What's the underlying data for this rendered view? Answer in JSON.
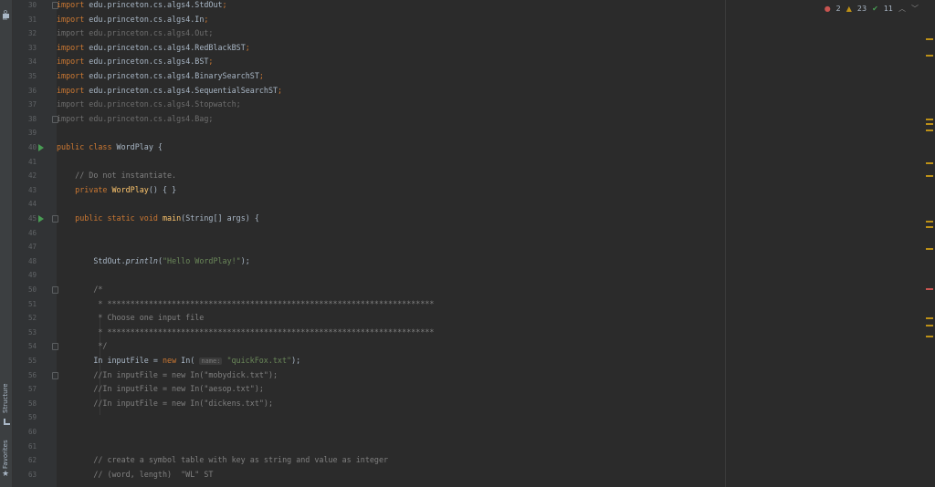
{
  "tool_windows": {
    "project": "Pro",
    "structure": "Structure",
    "favorites": "Favorites"
  },
  "inspections": {
    "errors": "2",
    "warnings": "23",
    "checks": "11"
  },
  "colors": {
    "keyword": "#cc7832",
    "string": "#6a8759",
    "comment": "#808080",
    "method": "#ffc66d",
    "error": "#c75450",
    "warning": "#be9117",
    "ok": "#499c54"
  },
  "lines": [
    {
      "n": "30",
      "t": [
        [
          "import",
          "kw"
        ],
        [
          " edu.princeton.cs.algs4.StdOut",
          ""
        ],
        [
          ";",
          "kw"
        ]
      ]
    },
    {
      "n": "31",
      "t": [
        [
          "import",
          "kw"
        ],
        [
          " edu.princeton.cs.algs4.In",
          ""
        ],
        [
          ";",
          "kw"
        ]
      ]
    },
    {
      "n": "32",
      "t": [
        [
          "import edu.princeton.cs.algs4.Out;",
          "dim"
        ]
      ]
    },
    {
      "n": "33",
      "t": [
        [
          "import",
          "kw"
        ],
        [
          " edu.princeton.cs.algs4.RedBlackBST",
          ""
        ],
        [
          ";",
          "kw"
        ]
      ]
    },
    {
      "n": "34",
      "t": [
        [
          "import",
          "kw"
        ],
        [
          " edu.princeton.cs.algs4.BST",
          ""
        ],
        [
          ";",
          "kw"
        ]
      ]
    },
    {
      "n": "35",
      "t": [
        [
          "import",
          "kw"
        ],
        [
          " edu.princeton.cs.algs4.BinarySearchST",
          ""
        ],
        [
          ";",
          "kw"
        ]
      ]
    },
    {
      "n": "36",
      "t": [
        [
          "import",
          "kw"
        ],
        [
          " edu.princeton.cs.algs4.SequentialSearchST",
          ""
        ],
        [
          ";",
          "kw"
        ]
      ]
    },
    {
      "n": "37",
      "t": [
        [
          "import edu.princeton.cs.algs4.Stopwatch;",
          "dim"
        ]
      ]
    },
    {
      "n": "38",
      "t": [
        [
          "import edu.princeton.cs.algs4.Bag;",
          "dim"
        ]
      ]
    },
    {
      "n": "39",
      "t": []
    },
    {
      "n": "40",
      "t": [
        [
          "public class",
          "kw"
        ],
        [
          " WordPlay {",
          ""
        ]
      ]
    },
    {
      "n": "41",
      "t": []
    },
    {
      "n": "42",
      "t": [
        [
          "    // Do not instantiate.",
          "cm"
        ]
      ]
    },
    {
      "n": "43",
      "t": [
        [
          "    private",
          "kw"
        ],
        [
          " ",
          ""
        ],
        [
          "WordPlay",
          "fn"
        ],
        [
          "() { }",
          ""
        ]
      ]
    },
    {
      "n": "44",
      "t": []
    },
    {
      "n": "45",
      "t": [
        [
          "    public static void",
          "kw"
        ],
        [
          " ",
          ""
        ],
        [
          "main",
          "fn"
        ],
        [
          "(String[] args) {",
          ""
        ]
      ]
    },
    {
      "n": "46",
      "t": []
    },
    {
      "n": "47",
      "t": []
    },
    {
      "n": "48",
      "t": [
        [
          "        StdOut.",
          ""
        ],
        [
          "println",
          "it"
        ],
        [
          "(",
          ""
        ],
        [
          "\"Hello WordPlay!\"",
          "str"
        ],
        [
          ");",
          ""
        ]
      ]
    },
    {
      "n": "49",
      "t": []
    },
    {
      "n": "50",
      "t": [
        [
          "        /*",
          "cm"
        ]
      ]
    },
    {
      "n": "51",
      "t": [
        [
          "         * ***********************************************************************",
          "cm"
        ]
      ]
    },
    {
      "n": "52",
      "t": [
        [
          "         * Choose one input file",
          "cm"
        ]
      ]
    },
    {
      "n": "53",
      "t": [
        [
          "         * ***********************************************************************",
          "cm"
        ]
      ]
    },
    {
      "n": "54",
      "t": [
        [
          "         */",
          "cm"
        ]
      ]
    },
    {
      "n": "55",
      "t": [
        [
          "        In inputFile = ",
          ""
        ],
        [
          "new",
          "kw"
        ],
        [
          " In( ",
          ""
        ],
        [
          "name:",
          "hint"
        ],
        [
          " ",
          ""
        ],
        [
          "\"quickFox.txt\"",
          "str"
        ],
        [
          ");",
          ""
        ]
      ]
    },
    {
      "n": "56",
      "t": [
        [
          "        //In inputFile = new In(\"mobydick.txt\");",
          "cm"
        ]
      ]
    },
    {
      "n": "57",
      "t": [
        [
          "        //In inputFile = new In(\"aesop.txt\");",
          "cm"
        ]
      ]
    },
    {
      "n": "58",
      "t": [
        [
          "        //In inputFile = new In(\"dickens.txt\");",
          "cm"
        ]
      ]
    },
    {
      "n": "59",
      "t": []
    },
    {
      "n": "60",
      "t": []
    },
    {
      "n": "61",
      "t": []
    },
    {
      "n": "62",
      "t": [
        [
          "        // create a symbol table with key as string and value as integer",
          "cm"
        ]
      ]
    },
    {
      "n": "63",
      "t": [
        [
          "        // (word, length)  \"WL\" ST",
          "cm"
        ]
      ]
    }
  ]
}
